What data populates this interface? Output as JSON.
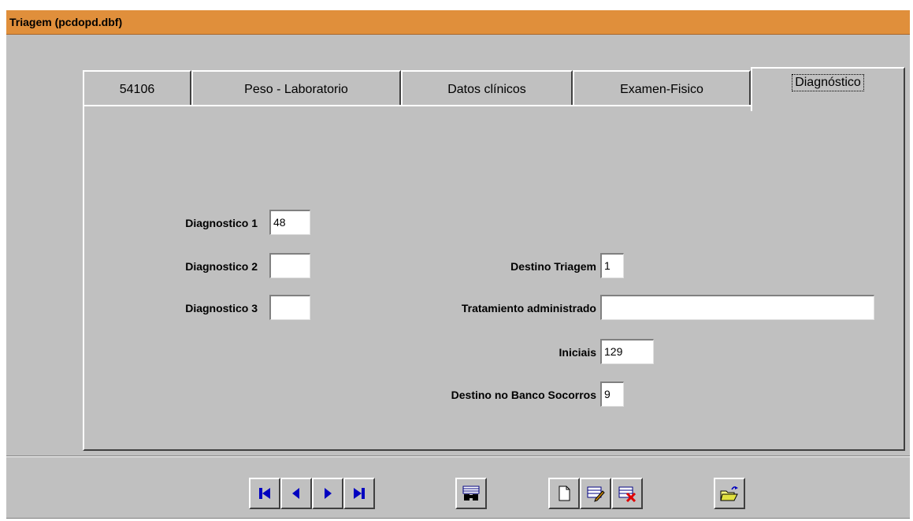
{
  "window": {
    "title": "Triagem (pcdopd.dbf)"
  },
  "tabs": [
    {
      "label": "54106",
      "active": false
    },
    {
      "label": "Peso - Laboratorio",
      "active": false
    },
    {
      "label": "Datos clínicos",
      "active": false
    },
    {
      "label": "Examen-Fisico",
      "active": false
    },
    {
      "label": "Diagnóstico",
      "active": true
    }
  ],
  "form": {
    "diagnostico1": {
      "label": "Diagnostico 1",
      "value": "48"
    },
    "diagnostico2": {
      "label": "Diagnostico 2",
      "value": ""
    },
    "diagnostico3": {
      "label": "Diagnostico 3",
      "value": ""
    },
    "destino_triagem": {
      "label": "Destino Triagem",
      "value": "1"
    },
    "tratamiento": {
      "label": "Tratamiento administrado",
      "value": ""
    },
    "iniciais": {
      "label": "Iniciais",
      "value": "129"
    },
    "destino_banco": {
      "label": "Destino no Banco Socorros",
      "value": "9"
    }
  },
  "toolbar": {
    "buttons": [
      {
        "icon": "first-record-icon"
      },
      {
        "icon": "previous-record-icon"
      },
      {
        "icon": "next-record-icon"
      },
      {
        "icon": "last-record-icon"
      },
      {
        "icon": "find-binoculars-icon"
      },
      {
        "icon": "new-record-icon"
      },
      {
        "icon": "edit-record-icon"
      },
      {
        "icon": "delete-record-icon"
      },
      {
        "icon": "open-folder-icon"
      }
    ],
    "nav_color": "#0000c0",
    "delete_color": "#e00000"
  }
}
